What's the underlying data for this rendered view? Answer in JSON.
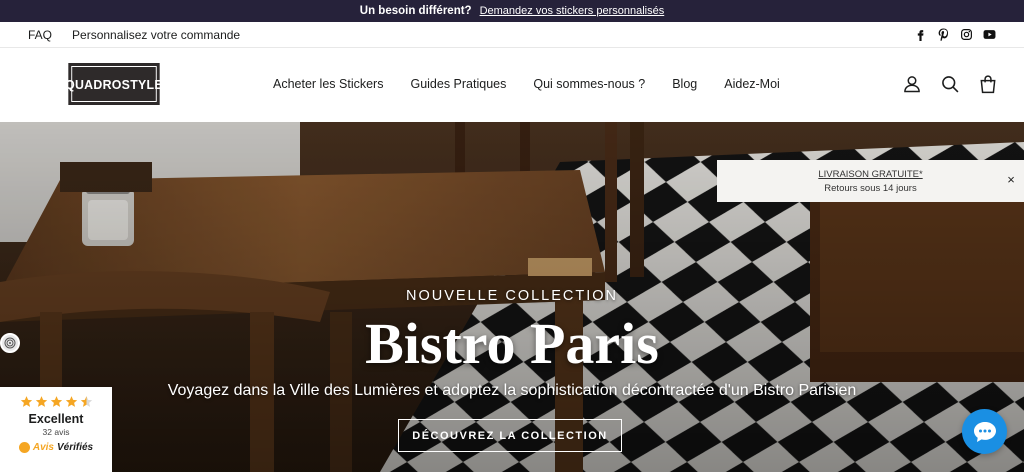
{
  "announcement": {
    "lead": "Un besoin différent?",
    "link": "Demandez vos stickers personnalisés"
  },
  "utility": {
    "links": [
      "FAQ",
      "Personnalisez votre commande"
    ],
    "social": [
      "facebook-icon",
      "pinterest-icon",
      "instagram-icon",
      "youtube-icon"
    ]
  },
  "header": {
    "logo": "QUADROSTYLE",
    "nav": [
      "Acheter les Stickers",
      "Guides Pratiques",
      "Qui sommes-nous ?",
      "Blog",
      "Aidez-Moi"
    ],
    "icons": [
      "account-icon",
      "search-icon",
      "cart-icon"
    ]
  },
  "hero": {
    "eyebrow": "NOUVELLE COLLECTION",
    "title": "Bistro Paris",
    "subtitle": "Voyagez dans la Ville des Lumières et adoptez la sophistication décontractée d'un Bistro Parisien",
    "cta": "DÉCOUVREZ LA COLLECTION"
  },
  "shipping_popup": {
    "headline": "LIVRAISON GRATUITE*",
    "subline": "Retours sous 14 jours",
    "close": "×"
  },
  "reviews": {
    "rating_label": "Excellent",
    "count": "32 avis",
    "brand_part1": "Avis",
    "brand_part2": "Vérifiés",
    "stars": 4.5
  },
  "colors": {
    "announcement_bg": "#26223a",
    "chat_bg": "#1a8fe3",
    "star": "#f5a623",
    "logo_bg": "#2e2a2a"
  }
}
